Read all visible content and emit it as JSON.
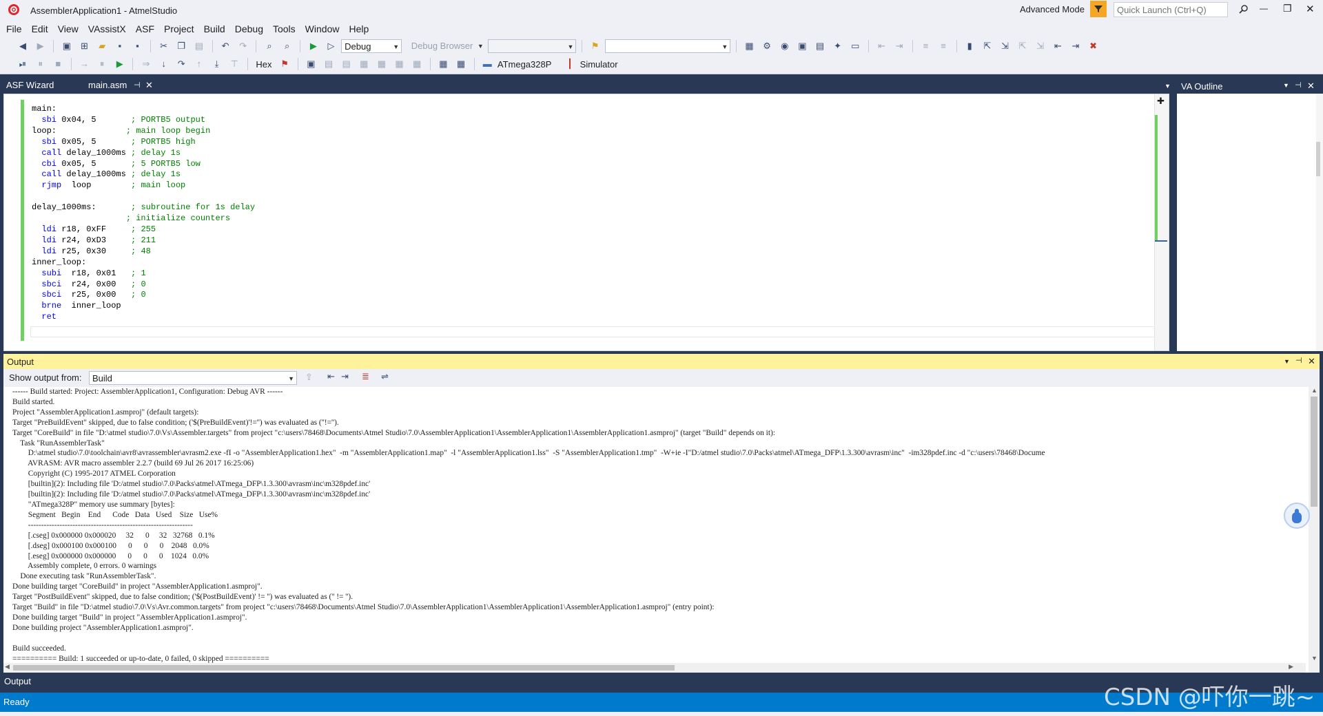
{
  "window": {
    "title": "AssemblerApplication1 - AtmelStudio",
    "advanced_mode": "Advanced Mode",
    "quick_launch_placeholder": "Quick Launch (Ctrl+Q)",
    "controls": [
      "—",
      "❐",
      "✕"
    ]
  },
  "menu": [
    "File",
    "Edit",
    "View",
    "VAssistX",
    "ASF",
    "Project",
    "Build",
    "Debug",
    "Tools",
    "Window",
    "Help"
  ],
  "toolbar": {
    "config_value": "Debug",
    "debug_browser": "Debug Browser",
    "hex_label": "Hex",
    "device_label": "ATmega328P",
    "simulator_label": "Simulator"
  },
  "tabs": {
    "asf_wizard": "ASF Wizard",
    "main_asm": "main.asm",
    "va_outline": "VA Outline"
  },
  "code_lines": [
    [
      [
        "lb",
        "main:"
      ]
    ],
    [
      [
        "kw",
        "  sbi"
      ],
      [
        "op",
        " 0x04, 5       "
      ],
      [
        "cm",
        "; PORTB5 output"
      ]
    ],
    [
      [
        "lb",
        "loop:"
      ],
      [
        "op",
        "              "
      ],
      [
        "cm",
        "; main loop begin"
      ]
    ],
    [
      [
        "kw",
        "  sbi"
      ],
      [
        "op",
        " 0x05, 5       "
      ],
      [
        "cm",
        "; PORTB5 high"
      ]
    ],
    [
      [
        "kw",
        "  call"
      ],
      [
        "op",
        " delay_1000ms "
      ],
      [
        "cm",
        "; delay 1s"
      ]
    ],
    [
      [
        "kw",
        "  cbi"
      ],
      [
        "op",
        " 0x05, 5       "
      ],
      [
        "cm",
        "; 5 PORTB5 low"
      ]
    ],
    [
      [
        "kw",
        "  call"
      ],
      [
        "op",
        " delay_1000ms "
      ],
      [
        "cm",
        "; delay 1s"
      ]
    ],
    [
      [
        "kw",
        "  rjmp"
      ],
      [
        "op",
        "  loop        "
      ],
      [
        "cm",
        "; main loop"
      ]
    ],
    [
      [
        "op",
        ""
      ]
    ],
    [
      [
        "lb",
        "delay_1000ms:"
      ],
      [
        "op",
        "       "
      ],
      [
        "cm",
        "; subroutine for 1s delay"
      ]
    ],
    [
      [
        "op",
        "                   "
      ],
      [
        "cm",
        "; initialize counters"
      ]
    ],
    [
      [
        "kw",
        "  ldi"
      ],
      [
        "op",
        " r18, 0xFF     "
      ],
      [
        "cm",
        "; 255"
      ]
    ],
    [
      [
        "kw",
        "  ldi"
      ],
      [
        "op",
        " r24, 0xD3     "
      ],
      [
        "cm",
        "; 211"
      ]
    ],
    [
      [
        "kw",
        "  ldi"
      ],
      [
        "op",
        " r25, 0x30     "
      ],
      [
        "cm",
        "; 48"
      ]
    ],
    [
      [
        "lb",
        "inner_loop:"
      ]
    ],
    [
      [
        "kw",
        "  subi"
      ],
      [
        "op",
        "  r18, 0x01   "
      ],
      [
        "cm",
        "; 1"
      ]
    ],
    [
      [
        "kw",
        "  sbci"
      ],
      [
        "op",
        "  r24, 0x00   "
      ],
      [
        "cm",
        "; 0"
      ]
    ],
    [
      [
        "kw",
        "  sbci"
      ],
      [
        "op",
        "  r25, 0x00   "
      ],
      [
        "cm",
        "; 0"
      ]
    ],
    [
      [
        "kw",
        "  brne"
      ],
      [
        "op",
        "  inner_loop"
      ]
    ],
    [
      [
        "kw",
        "  ret"
      ]
    ]
  ],
  "output": {
    "title": "Output",
    "show_output_from": "Show output from:",
    "source": "Build",
    "lines": [
      "------ Build started: Project: AssemblerApplication1, Configuration: Debug AVR ------",
      "Build started.",
      "Project \"AssemblerApplication1.asmproj\" (default targets):",
      "Target \"PreBuildEvent\" skipped, due to false condition; ('$(PreBuildEvent)'!='') was evaluated as (''!='').",
      "Target \"CoreBuild\" in file \"D:\\atmel studio\\7.0\\Vs\\Assembler.targets\" from project \"c:\\users\\78468\\Documents\\Atmel Studio\\7.0\\AssemblerApplication1\\AssemblerApplication1\\AssemblerApplication1.asmproj\" (target \"Build\" depends on it):",
      "    Task \"RunAssemblerTask\"",
      "        D:\\atmel studio\\7.0\\toolchain\\avr8\\avrassembler\\avrasm2.exe -fI -o \"AssemblerApplication1.hex\"  -m \"AssemblerApplication1.map\"  -l \"AssemblerApplication1.lss\"  -S \"AssemblerApplication1.tmp\"  -W+ie -I\"D:/atmel studio\\7.0\\Packs\\atmel\\ATmega_DFP\\1.3.300\\avrasm\\inc\"  -im328pdef.inc -d \"c:\\users\\78468\\Docume",
      "        AVRASM: AVR macro assembler 2.2.7 (build 69 Jul 26 2017 16:25:06)",
      "        Copyright (C) 1995-2017 ATMEL Corporation",
      "        [builtin](2): Including file 'D:/atmel studio\\7.0\\Packs\\atmel\\ATmega_DFP\\1.3.300\\avrasm\\inc\\m328pdef.inc'",
      "        [builtin](2): Including file 'D:/atmel studio\\7.0\\Packs\\atmel\\ATmega_DFP\\1.3.300\\avrasm\\inc\\m328pdef.inc'",
      "        \"ATmega328P\" memory use summary [bytes]:",
      "        Segment   Begin    End      Code   Data   Used    Size   Use%",
      "        ---------------------------------------------------------------",
      "        [.cseg] 0x000000 0x000020     32      0     32   32768   0.1%",
      "        [.dseg] 0x000100 0x000100      0      0      0    2048   0.0%",
      "        [.eseg] 0x000000 0x000000      0      0      0    1024   0.0%",
      "        Assembly complete, 0 errors. 0 warnings",
      "    Done executing task \"RunAssemblerTask\".",
      "Done building target \"CoreBuild\" in project \"AssemblerApplication1.asmproj\".",
      "Target \"PostBuildEvent\" skipped, due to false condition; ('$(PostBuildEvent)' != '') was evaluated as ('' != '').",
      "Target \"Build\" in file \"D:\\atmel studio\\7.0\\Vs\\Avr.common.targets\" from project \"c:\\users\\78468\\Documents\\Atmel Studio\\7.0\\AssemblerApplication1\\AssemblerApplication1\\AssemblerApplication1.asmproj\" (entry point):",
      "Done building target \"Build\" in project \"AssemblerApplication1.asmproj\".",
      "Done building project \"AssemblerApplication1.asmproj\".",
      "",
      "Build succeeded.",
      "========== Build: 1 succeeded or up-to-date, 0 failed, 0 skipped =========="
    ]
  },
  "bottom_tab": "Output",
  "status": "Ready",
  "watermark": "CSDN @吓你一跳~",
  "colors": {
    "statusbar": "#007acc",
    "frame": "#293955",
    "output_header": "#fff29d"
  }
}
